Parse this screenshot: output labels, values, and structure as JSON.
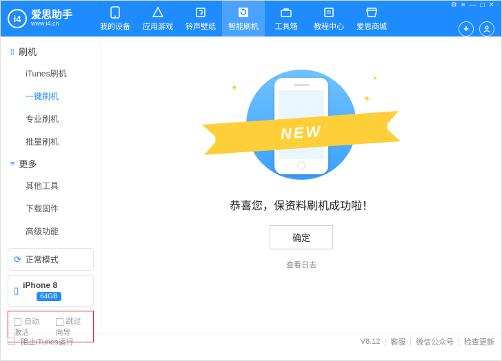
{
  "logo": {
    "badge": "i4",
    "title": "爱思助手",
    "subtitle": "www.i4.cn"
  },
  "nav": [
    {
      "label": "我的设备",
      "icon": "phone"
    },
    {
      "label": "应用游戏",
      "icon": "apps"
    },
    {
      "label": "铃声壁纸",
      "icon": "music"
    },
    {
      "label": "智能刷机",
      "icon": "refresh"
    },
    {
      "label": "工具箱",
      "icon": "toolbox"
    },
    {
      "label": "教程中心",
      "icon": "book"
    },
    {
      "label": "爱思商城",
      "icon": "shop"
    }
  ],
  "sidebar": {
    "group1": {
      "title": "刷机",
      "items": [
        "iTunes刷机",
        "一键刷机",
        "专业刷机",
        "批量刷机"
      ],
      "activeIndex": 1
    },
    "group2": {
      "title": "更多",
      "items": [
        "其他工具",
        "下载固件",
        "高级功能"
      ]
    },
    "mode": "正常模式",
    "device": {
      "name": "iPhone 8",
      "storage": "64GB"
    }
  },
  "options": {
    "auto_activate": "自动激活",
    "skip_guide": "跳过向导"
  },
  "main": {
    "ribbon": "NEW",
    "success": "恭喜您，保资料刷机成功啦！",
    "ok": "确定",
    "log": "查看日志"
  },
  "footer": {
    "block_itunes": "阻止iTunes运行",
    "version": "V8.12",
    "support": "客服",
    "wechat": "微信公众号",
    "update": "检查更新"
  }
}
